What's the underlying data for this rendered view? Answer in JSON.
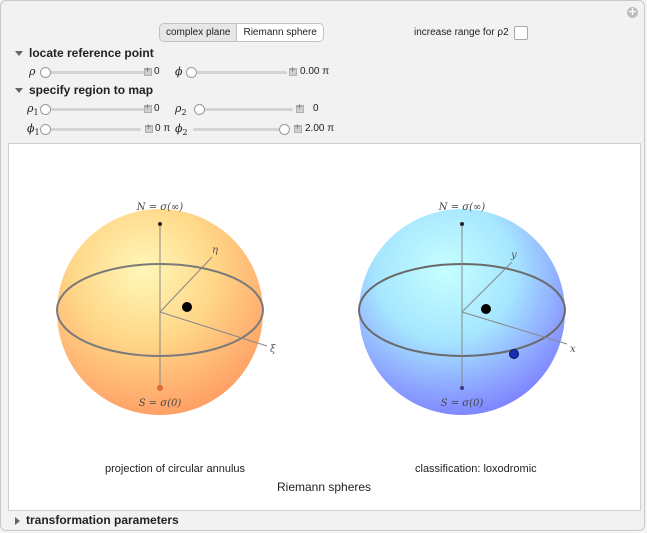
{
  "tabs": [
    "complex plane",
    "Riemann sphere"
  ],
  "active_tab": "Riemann sphere",
  "range_label": "increase range for ρ2",
  "range_checked": false,
  "sections": {
    "reference": "locate reference point",
    "region": "specify region to map",
    "transform": "transformation parameters"
  },
  "sliders": {
    "rho": {
      "label": "ρ",
      "value": "0",
      "fraction": 0
    },
    "phi": {
      "label": "ϕ",
      "value": "0.00 π",
      "fraction": 0
    },
    "rho1": {
      "label": "ρ1",
      "value": "0",
      "fraction": 0
    },
    "rho2": {
      "label": "ρ2",
      "value": "0",
      "fraction": 0
    },
    "phi1": {
      "label": "ϕ1",
      "value": "0 π",
      "fraction": 0
    },
    "phi2": {
      "label": "ϕ2",
      "value": "2.00 π",
      "fraction": 1
    }
  },
  "sphere_left": {
    "north": "N = σ(∞)",
    "south": "S = σ(0)",
    "axis1": "η",
    "axis2": "ξ",
    "caption": "projection of circular annulus",
    "color": "#ffbe6b"
  },
  "sphere_right": {
    "north": "N = σ(∞)",
    "south": "S = σ(0)",
    "axis1": "y",
    "axis2": "x",
    "caption": "classification: loxodromic",
    "color": "#7f95ff"
  },
  "plot_title": "Riemann spheres"
}
